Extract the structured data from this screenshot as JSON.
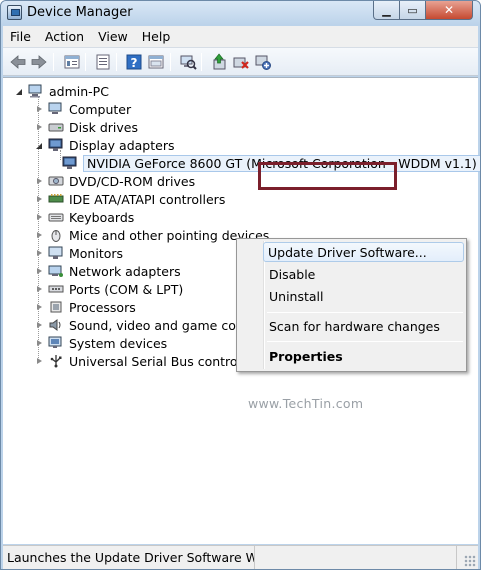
{
  "window": {
    "title": "Device Manager"
  },
  "menu": [
    "File",
    "Action",
    "View",
    "Help"
  ],
  "toolbar_icons": [
    "back-icon",
    "forward-icon",
    "properties-list-icon",
    "show-hidden-icon",
    "help-icon",
    "console-tree-icon",
    "scan-hardware-icon",
    "update-driver-icon",
    "uninstall-icon",
    "disable-icon"
  ],
  "tree": {
    "root": "admin-PC",
    "categories": [
      {
        "label": "Computer",
        "icon": "computer-icon"
      },
      {
        "label": "Disk drives",
        "icon": "disk-drive-icon"
      },
      {
        "label": "Display adapters",
        "icon": "display-adapter-icon"
      },
      {
        "label": "NVIDIA GeForce 8600 GT (Microsoft Corporation - WDDM v1.1)",
        "icon": "display-adapter-icon"
      },
      {
        "label": "DVD/CD-ROM drives",
        "icon": "dvd-icon"
      },
      {
        "label": "IDE ATA/ATAPI controllers",
        "icon": "ide-controller-icon"
      },
      {
        "label": "Keyboards",
        "icon": "keyboard-icon"
      },
      {
        "label": "Mice and other pointing devices",
        "icon": "mouse-icon"
      },
      {
        "label": "Monitors",
        "icon": "monitor-icon"
      },
      {
        "label": "Network adapters",
        "icon": "network-adapter-icon"
      },
      {
        "label": "Ports (COM & LPT)",
        "icon": "port-icon"
      },
      {
        "label": "Processors",
        "icon": "processor-icon"
      },
      {
        "label": "Sound, video and game controllers",
        "icon": "sound-icon"
      },
      {
        "label": "System devices",
        "icon": "system-device-icon"
      },
      {
        "label": "Universal Serial Bus controllers",
        "icon": "usb-icon"
      }
    ]
  },
  "context_menu": {
    "update": "Update Driver Software...",
    "disable": "Disable",
    "uninstall": "Uninstall",
    "scan": "Scan for hardware changes",
    "properties": "Properties"
  },
  "watermark": "www.TechTin.com",
  "status": "Launches the Update Driver Software Wizard fo",
  "colors": {
    "highlight_box": "#7b1f2b",
    "selection": "#a9c8ea"
  }
}
